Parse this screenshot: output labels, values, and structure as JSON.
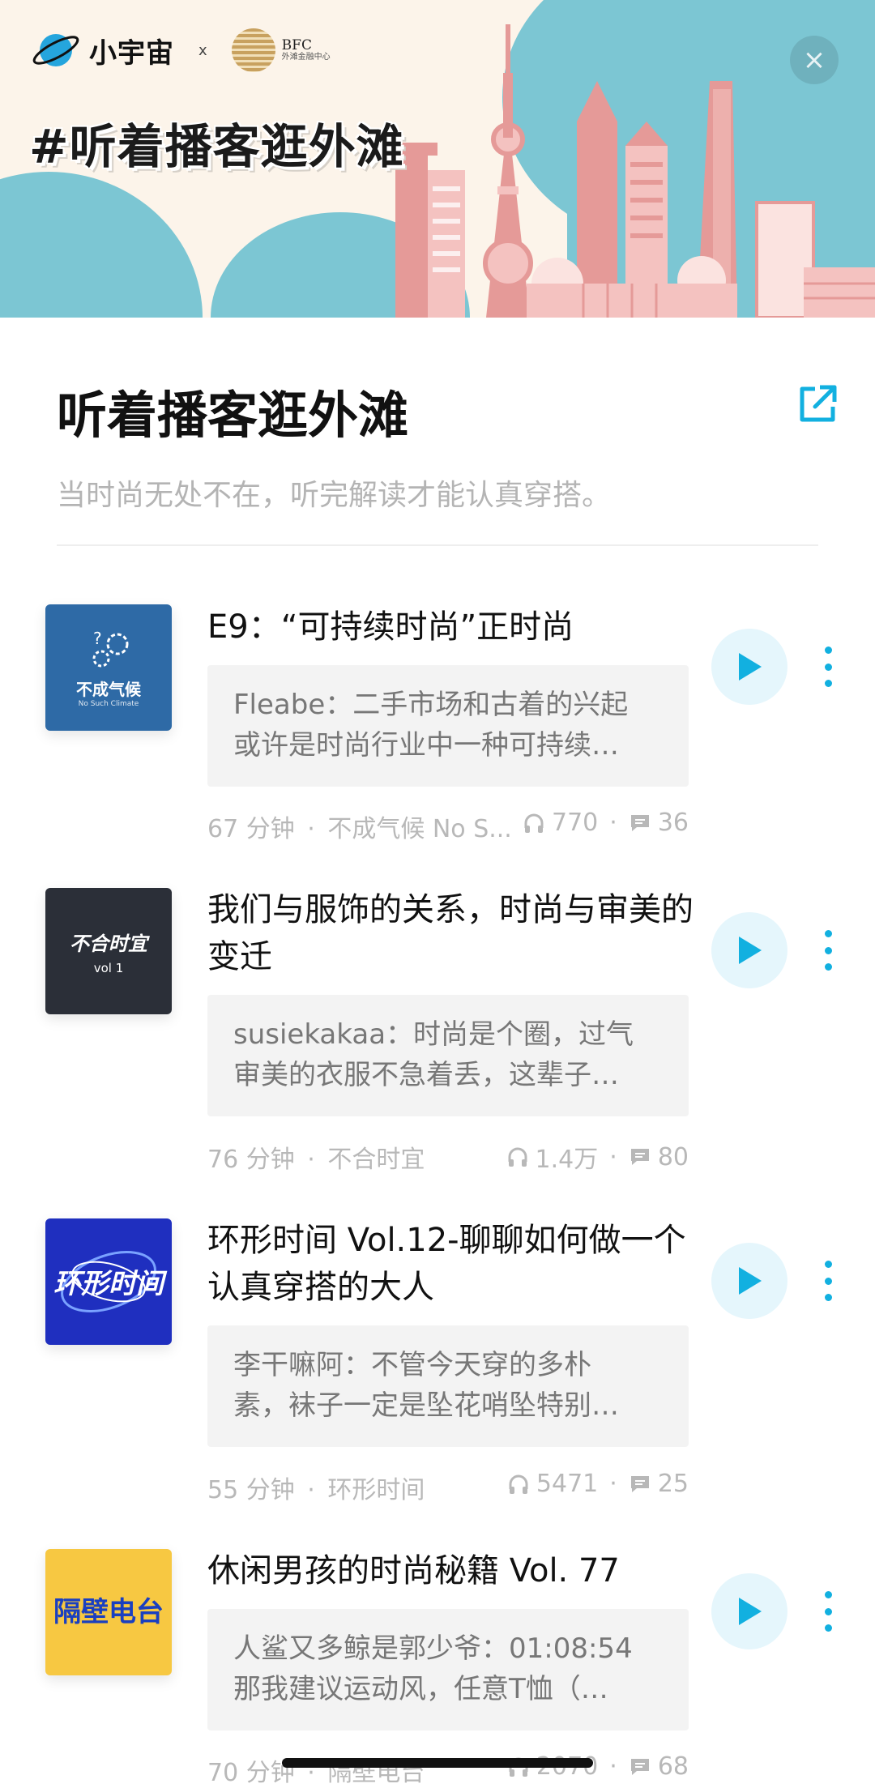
{
  "banner": {
    "brand_name": "小宇宙",
    "collab_x": "x",
    "partner_main": "BFC",
    "partner_sub": "外滩金融中心",
    "hashtag": "#听着播客逛外滩",
    "close_label": "×"
  },
  "header": {
    "title": "听着播客逛外滩",
    "subtitle": "当时尚无处不在，听完解读才能认真穿搭。"
  },
  "episodes": [
    {
      "cover_title": "不成气候",
      "cover_sub": "No Such Climate",
      "title": "E9：“可持续时尚”正时尚",
      "comment_line1": "Fleabe：二手市场和古着的兴起",
      "comment_line2": "或许是时尚行业中一种可持续…",
      "duration": "67 分钟",
      "podcast": "不成气候 No S...",
      "listens": "770",
      "comments": "36"
    },
    {
      "cover_title": "不合时宜",
      "cover_sub": "vol 1",
      "title": "我们与服饰的关系，时尚与审美的变迁",
      "comment_line1": "susiekakaa：时尚是个圈，过气",
      "comment_line2": "审美的衣服不急着丢，这辈子…",
      "duration": "76 分钟",
      "podcast": "不合时宜",
      "listens": "1.4万",
      "comments": "80"
    },
    {
      "cover_title": "环形时间",
      "cover_sub": "",
      "title": "环形时间 Vol.12-聊聊如何做一个认真穿搭的大人",
      "comment_line1": "李干嘛阿：不管今天穿的多朴",
      "comment_line2": "素，袜子一定是坠花哨坠特别…",
      "duration": "55 分钟",
      "podcast": "环形时间",
      "listens": "5471",
      "comments": "25"
    },
    {
      "cover_title": "隔壁电台",
      "cover_sub": "",
      "title": "休闲男孩的时尚秘籍 Vol. 77",
      "comment_line1": "人鲨又多鲸是郭少爷：01:08:54",
      "comment_line2": "那我建议运动风，任意T恤（…",
      "duration": "70 分钟",
      "podcast": "隔壁电台",
      "listens": "2070",
      "comments": "68"
    }
  ],
  "colors": {
    "accent": "#12b0e0",
    "play_bg": "#e5f6fc",
    "banner_bg": "#fcf4ea",
    "cloud": "#7cc6d3",
    "building": "#e59a98"
  }
}
